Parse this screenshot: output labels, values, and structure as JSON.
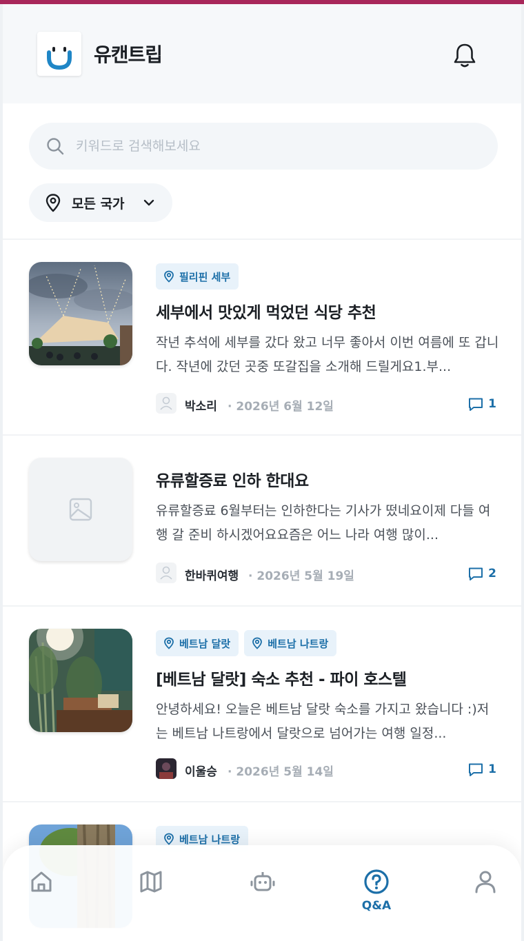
{
  "app": {
    "title": "유캔트립"
  },
  "search": {
    "placeholder": "키워드로 검색해보세요"
  },
  "filter": {
    "country_label": "모든 국가"
  },
  "posts": [
    {
      "tags": [
        "필리핀 세부"
      ],
      "title": "세부에서 맛있게 먹었던 식당 추천",
      "excerpt": "작년 추석에 세부를 갔다 왔고 너무 좋아서 이번 여름에 또 갑니다. 작년에 갔던 곳중 또갈집을 소개해 드릴게요1.부...",
      "author": "박소리",
      "date": "2026년 6월 12일",
      "comments": "1"
    },
    {
      "tags": [],
      "title": "유류할증료 인하 한대요",
      "excerpt": "유류할증료 6월부터는 인하한다는 기사가 떴네요이제 다들 여행 갈 준비 하시겠어요요즘은 어느 나라 여행 많이...",
      "author": "한바퀴여행",
      "date": "2026년 5월 19일",
      "comments": "2"
    },
    {
      "tags": [
        "베트남 달랏",
        "베트남 나트랑"
      ],
      "title": "[베트남 달랏] 숙소 추천 - 파이 호스텔",
      "excerpt": "안녕하세요! 오늘은 베트남 달랏 숙소를 가지고 왔습니다 :)저는 베트남 나트랑에서 달랏으로 넘어가는 여행 일정...",
      "author": "이울승",
      "date": "2026년 5월 14일",
      "comments": "1"
    },
    {
      "tags": [
        "베트남 나트랑"
      ]
    }
  ],
  "nav": {
    "items": [
      {
        "icon": "home-icon",
        "label": ""
      },
      {
        "icon": "map-icon",
        "label": ""
      },
      {
        "icon": "bot-icon",
        "label": ""
      },
      {
        "icon": "question-icon",
        "label": "Q&A",
        "active": true
      },
      {
        "icon": "user-icon",
        "label": ""
      }
    ]
  },
  "colors": {
    "accent": "#1c6fa8",
    "tag_bg": "#e8f2fa",
    "top_strip": "#a8275a"
  }
}
